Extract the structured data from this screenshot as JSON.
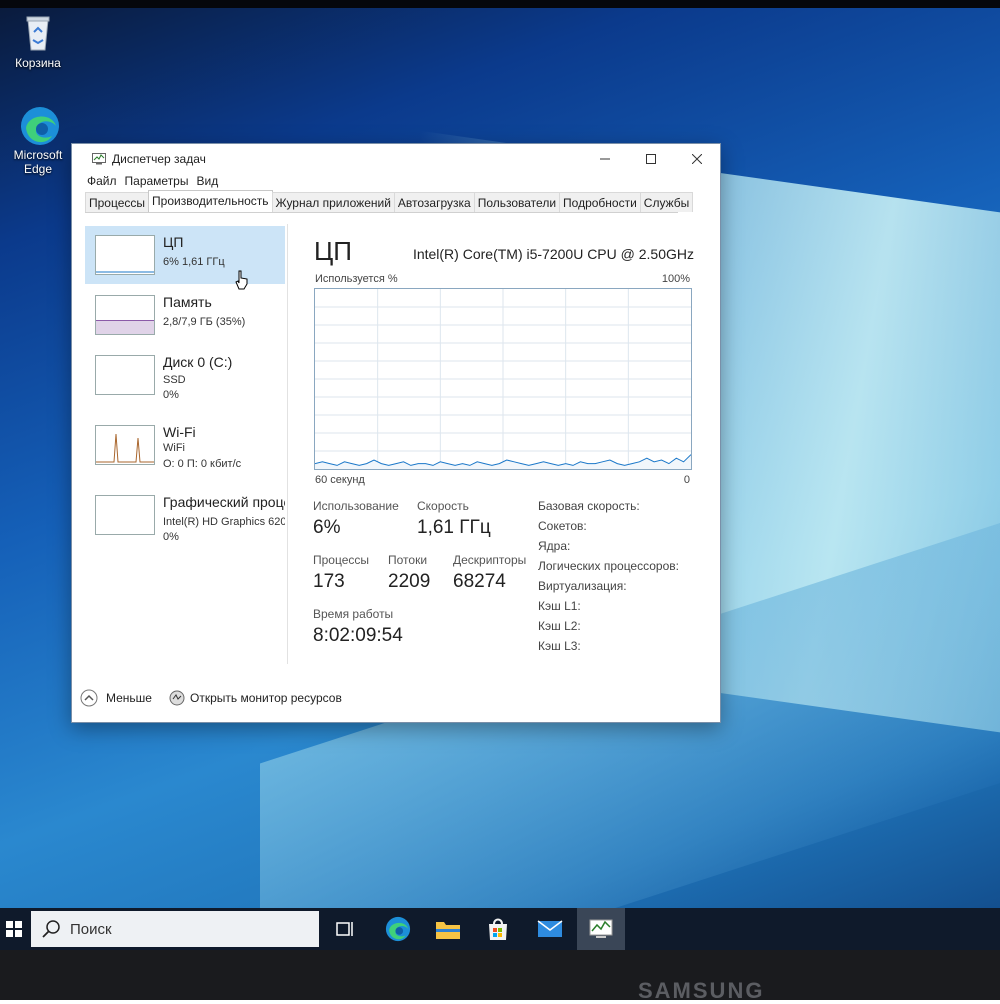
{
  "desktop": {
    "icons": [
      {
        "label": "Корзина"
      },
      {
        "label": "Microsoft Edge"
      }
    ],
    "brand": "SAMSUNG"
  },
  "window": {
    "title": "Диспетчер задач",
    "menu": [
      "Файл",
      "Параметры",
      "Вид"
    ],
    "tabs": [
      "Процессы",
      "Производительность",
      "Журнал приложений",
      "Автозагрузка",
      "Пользователи",
      "Подробности",
      "Службы"
    ],
    "active_tab": "Производительность"
  },
  "sidebar": {
    "items": [
      {
        "name": "ЦП",
        "line1": "6%  1,61 ГГц",
        "line2": "",
        "selected": true
      },
      {
        "name": "Память",
        "line1": "2,8/7,9 ГБ (35%)",
        "line2": ""
      },
      {
        "name": "Диск 0 (C:)",
        "line1": "SSD",
        "line2": "0%"
      },
      {
        "name": "Wi-Fi",
        "line1": "WiFi",
        "line2": "О: 0  П: 0 кбит/с"
      },
      {
        "name": "Графический процессор 0",
        "line1": "Intel(R) HD Graphics 620",
        "line2": "0%"
      }
    ],
    "memory_fill_percent": 35
  },
  "cpu": {
    "heading": "ЦП",
    "model": "Intel(R) Core(TM) i5-7200U CPU @ 2.50GHz",
    "graph_label": "Используется %",
    "graph_max": "100%",
    "graph_time": "60 секунд",
    "graph_min": "0",
    "stats": {
      "usage_label": "Использование",
      "usage": "6%",
      "speed_label": "Скорость",
      "speed": "1,61 ГГц",
      "processes_label": "Процессы",
      "processes": "173",
      "threads_label": "Потоки",
      "threads": "2209",
      "handles_label": "Дескрипторы",
      "handles": "68274",
      "uptime_label": "Время работы",
      "uptime": "8:02:09:54"
    },
    "info": [
      "Базовая скорость:",
      "Сокетов:",
      "Ядра:",
      "Логических процессоров:",
      "Виртуализация:",
      "Кэш L1:",
      "Кэш L2:",
      "Кэш L3:"
    ],
    "series_percent": [
      3,
      4,
      3,
      2,
      4,
      3,
      2,
      3,
      5,
      3,
      2,
      3,
      4,
      2,
      3,
      3,
      2,
      4,
      3,
      2,
      3,
      2,
      4,
      3,
      2,
      3,
      5,
      4,
      3,
      2,
      3,
      4,
      3,
      2,
      3,
      2,
      4,
      3,
      3,
      4,
      5,
      3,
      2,
      3,
      4,
      6,
      4,
      5,
      3,
      6,
      4,
      8
    ]
  },
  "footer": {
    "less": "Меньше",
    "resource_monitor": "Открыть монитор ресурсов"
  },
  "taskbar": {
    "search_placeholder": "Поиск"
  }
}
